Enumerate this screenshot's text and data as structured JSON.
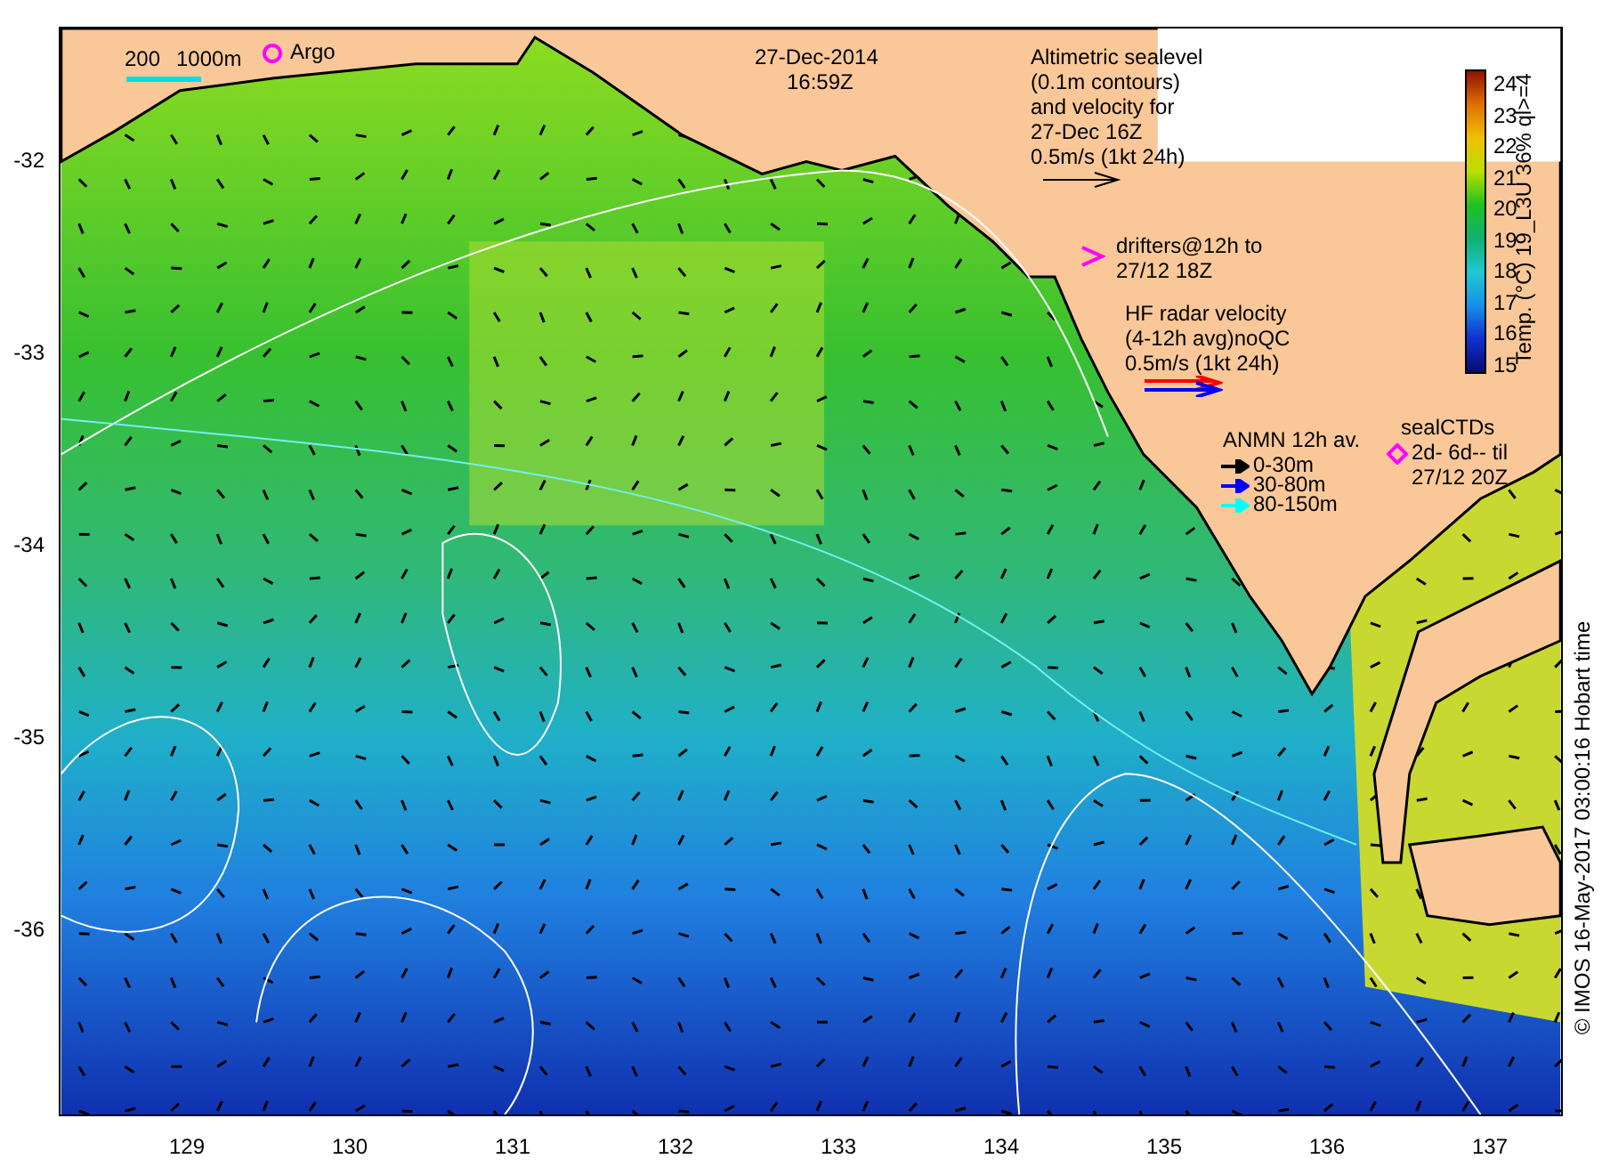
{
  "header": {
    "date": "27-Dec-2014",
    "time": "16:59Z"
  },
  "legend": {
    "scale_labels": [
      "200",
      "1000m"
    ],
    "argo": "Argo",
    "altimetry": [
      "Altimetric sealevel",
      "(0.1m contours)",
      "and velocity for",
      "27-Dec 16Z",
      "0.5m/s (1kt 24h)"
    ],
    "drifters": [
      "drifters@12h to",
      "27/12 18Z"
    ],
    "hf_radar": [
      "HF radar velocity",
      "(4-12h avg)noQC",
      "0.5m/s (1kt 24h)"
    ],
    "anmn": {
      "title": "ANMN 12h av.",
      "items": [
        {
          "label": "0-30m",
          "color": "#000000"
        },
        {
          "label": "30-80m",
          "color": "#0000ff"
        },
        {
          "label": "80-150m",
          "color": "#00ffff"
        }
      ]
    },
    "seal_ctds": {
      "title": "sealCTDs",
      "lines": [
        "2d- 6d-- til",
        "27/12 20Z"
      ]
    }
  },
  "colorbar": {
    "label": "Temp. (°C) 19_L3U 36% ql>=4",
    "ticks": [
      "24",
      "23",
      "22",
      "21",
      "20",
      "19",
      "18",
      "17",
      "16",
      "15"
    ]
  },
  "x_axis": [
    "129",
    "130",
    "131",
    "132",
    "133",
    "134",
    "135",
    "136",
    "137"
  ],
  "y_axis": [
    "-32",
    "-33",
    "-34",
    "-35",
    "-36"
  ],
  "credit": "© IMOS 16-May-2017 03:00:16 Hobart time"
}
